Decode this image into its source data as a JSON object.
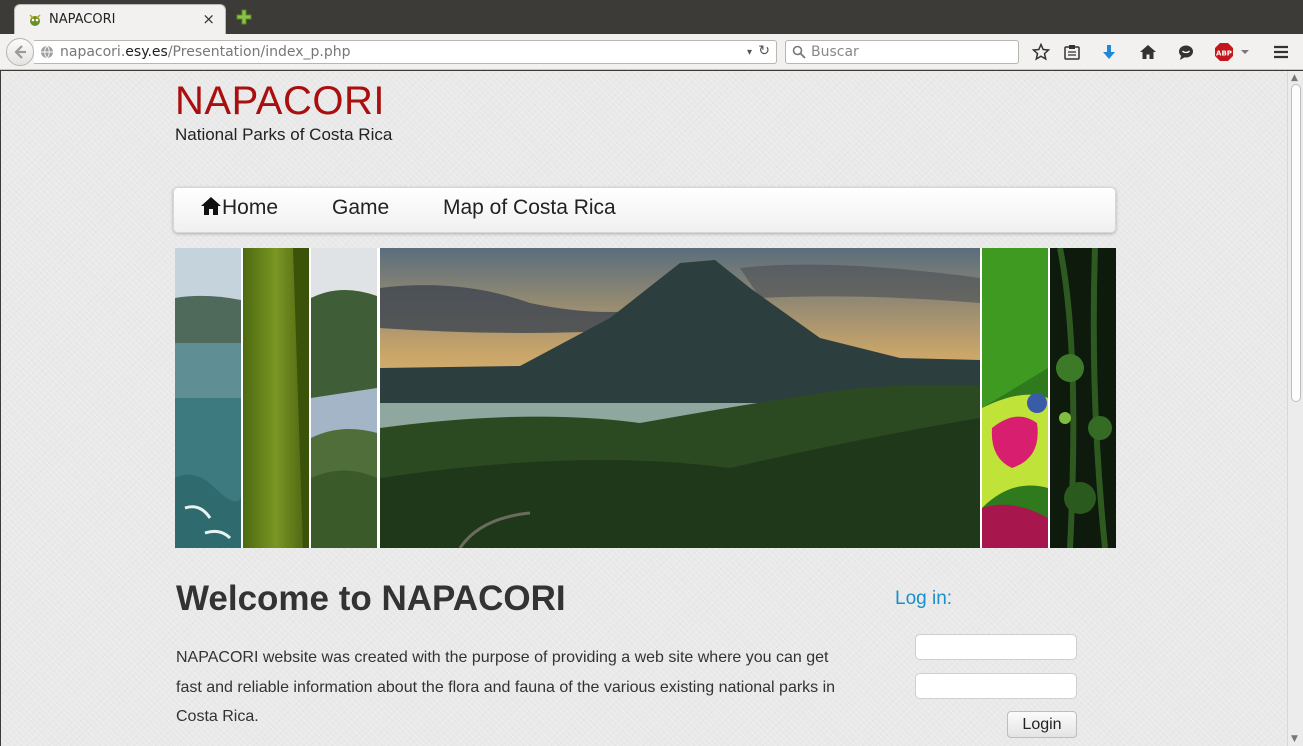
{
  "browser": {
    "tab_title": "NAPACORI",
    "tab_close": "×",
    "url_prefix": "napacori.",
    "url_domain": "esy.es",
    "url_path": "/Presentation/index_p.php",
    "url_dropdown": "▾",
    "url_reload": "↻",
    "search_placeholder": "Buscar",
    "toolbar_icons": [
      "bookmark-star-icon",
      "reading-list-icon",
      "download-icon",
      "home-icon",
      "chat-icon",
      "adblock-icon",
      "menu-icon"
    ],
    "adblock_label": "ABP",
    "accent_download": "#1e88d8",
    "adblock_color": "#c4161c"
  },
  "site": {
    "title": "NAPACORI",
    "subtitle": "National Parks of Costa Rica",
    "title_color": "#aa0f0f"
  },
  "nav": {
    "home": "Home",
    "game": "Game",
    "map": "Map of Costa Rica"
  },
  "banner": {
    "strips": [
      "coastline-photo",
      "green-leaf-photo",
      "lagoon-forest-photo",
      "arenal-volcano-photo",
      "red-eyed-frog-photo",
      "jungle-vines-photo"
    ]
  },
  "main": {
    "heading": "Welcome to NAPACORI",
    "intro": "NAPACORI website was created with the purpose of providing a web site where you can get fast and reliable information about the flora and fauna of the various existing national parks in Costa Rica."
  },
  "login": {
    "title": "Log in:",
    "username_value": "",
    "password_value": "",
    "button": "Login",
    "title_color": "#1a8fc9"
  }
}
